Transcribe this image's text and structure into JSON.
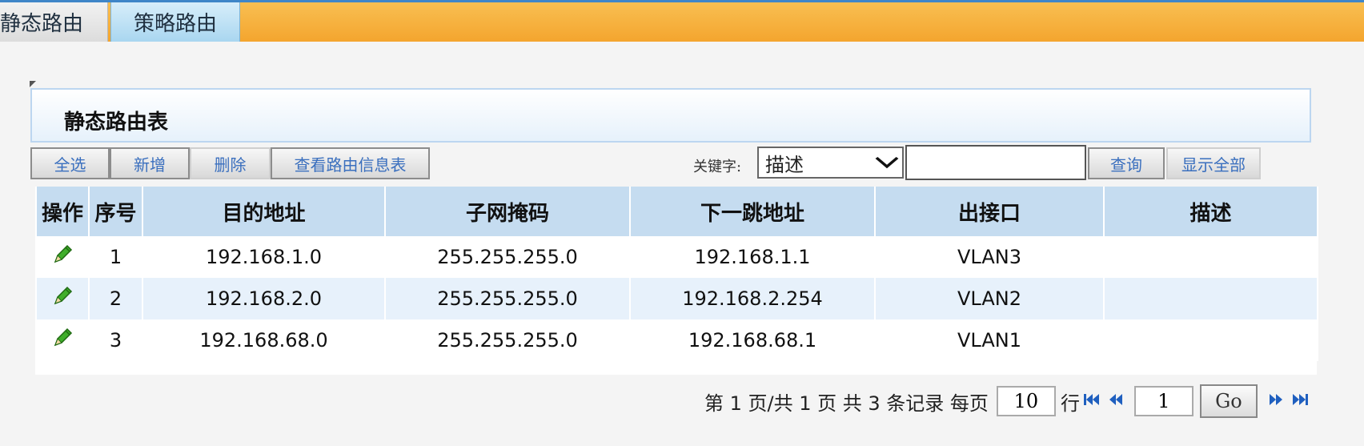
{
  "tabs": [
    {
      "label": "静态路由"
    },
    {
      "label": "策略路由"
    }
  ],
  "section": {
    "title": "静态路由表"
  },
  "toolbar": {
    "select_all": "全选",
    "add": "新增",
    "delete": "删除",
    "view_info": "查看路由信息表",
    "keyword_label": "关键字:",
    "keyword_selected": "描述",
    "keyword_value": "",
    "query": "查询",
    "show_all": "显示全部"
  },
  "table": {
    "headers": [
      "操作",
      "序号",
      "目的地址",
      "子网掩码",
      "下一跳地址",
      "出接口",
      "描述"
    ],
    "rows": [
      {
        "index": "1",
        "dest": "192.168.1.0",
        "mask": "255.255.255.0",
        "next_hop": "192.168.1.1",
        "iface": "VLAN3",
        "desc": ""
      },
      {
        "index": "2",
        "dest": "192.168.2.0",
        "mask": "255.255.255.0",
        "next_hop": "192.168.2.254",
        "iface": "VLAN2",
        "desc": ""
      },
      {
        "index": "3",
        "dest": "192.168.68.0",
        "mask": "255.255.255.0",
        "next_hop": "192.168.68.1",
        "iface": "VLAN1",
        "desc": ""
      }
    ]
  },
  "pager": {
    "summary": "第 1 页/共 1 页 共 3 条记录 每页",
    "page_size": "10",
    "rows_unit": "行",
    "current_page": "1",
    "go": "Go"
  },
  "icons": {
    "edit": "pencil-icon",
    "first": "first-page-icon",
    "prev": "prev-page-icon",
    "next": "next-page-icon",
    "last": "last-page-icon"
  },
  "colors": {
    "tabbar": "#f4a52e",
    "header_row": "#c5dcf0",
    "alt_row": "#e7f1fb",
    "link_blue": "#3a6fbe",
    "nav_blue": "#1f5fbf"
  }
}
